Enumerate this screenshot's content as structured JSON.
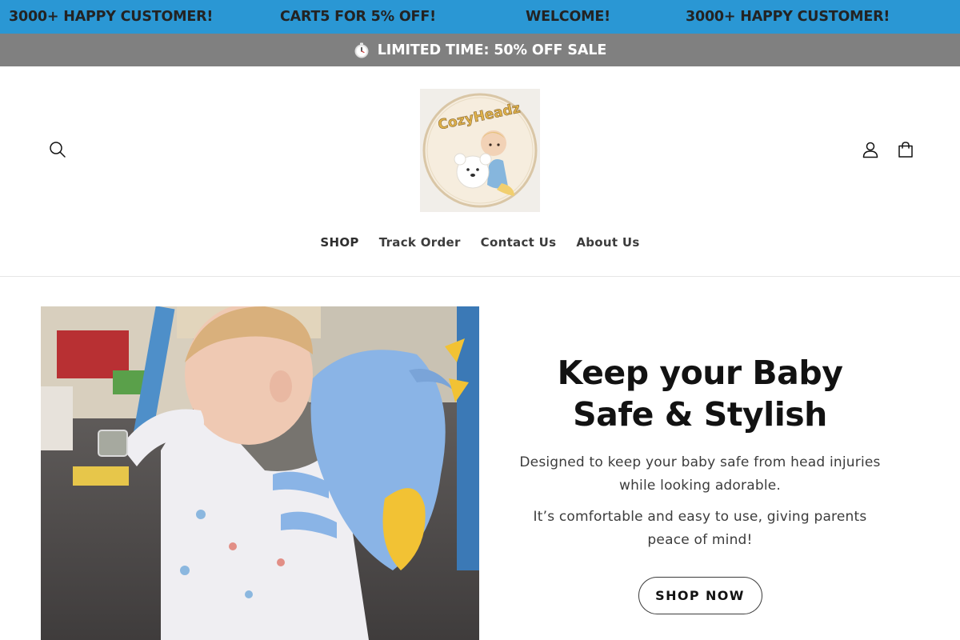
{
  "marquee": {
    "items": [
      "3000+ HAPPY CUSTOMER!",
      "CART5 FOR 5% OFF!",
      "WELCOME!",
      "3000+ HAPPY CUSTOMER!"
    ],
    "bg_color": "#2a97d4"
  },
  "announcement": {
    "icon": "stopwatch-icon",
    "text": "LIMITED TIME: 50% OFF SALE",
    "bg_color": "#808080"
  },
  "header": {
    "icons": {
      "search": "search-icon",
      "account": "user-icon",
      "cart": "shopping-bag-icon"
    },
    "logo": {
      "text": "CozyHeadz"
    }
  },
  "nav": {
    "items": [
      "SHOP",
      "Track Order",
      "Contact Us",
      "About Us"
    ]
  },
  "hero": {
    "title_line1": "Keep your Baby",
    "title_line2": "Safe & Stylish",
    "paragraph1": "Designed to keep your baby safe from head injuries while looking adorable.",
    "paragraph2": "It’s comfortable and easy to use, giving parents peace of mind!",
    "button_label": "SHOP NOW"
  }
}
